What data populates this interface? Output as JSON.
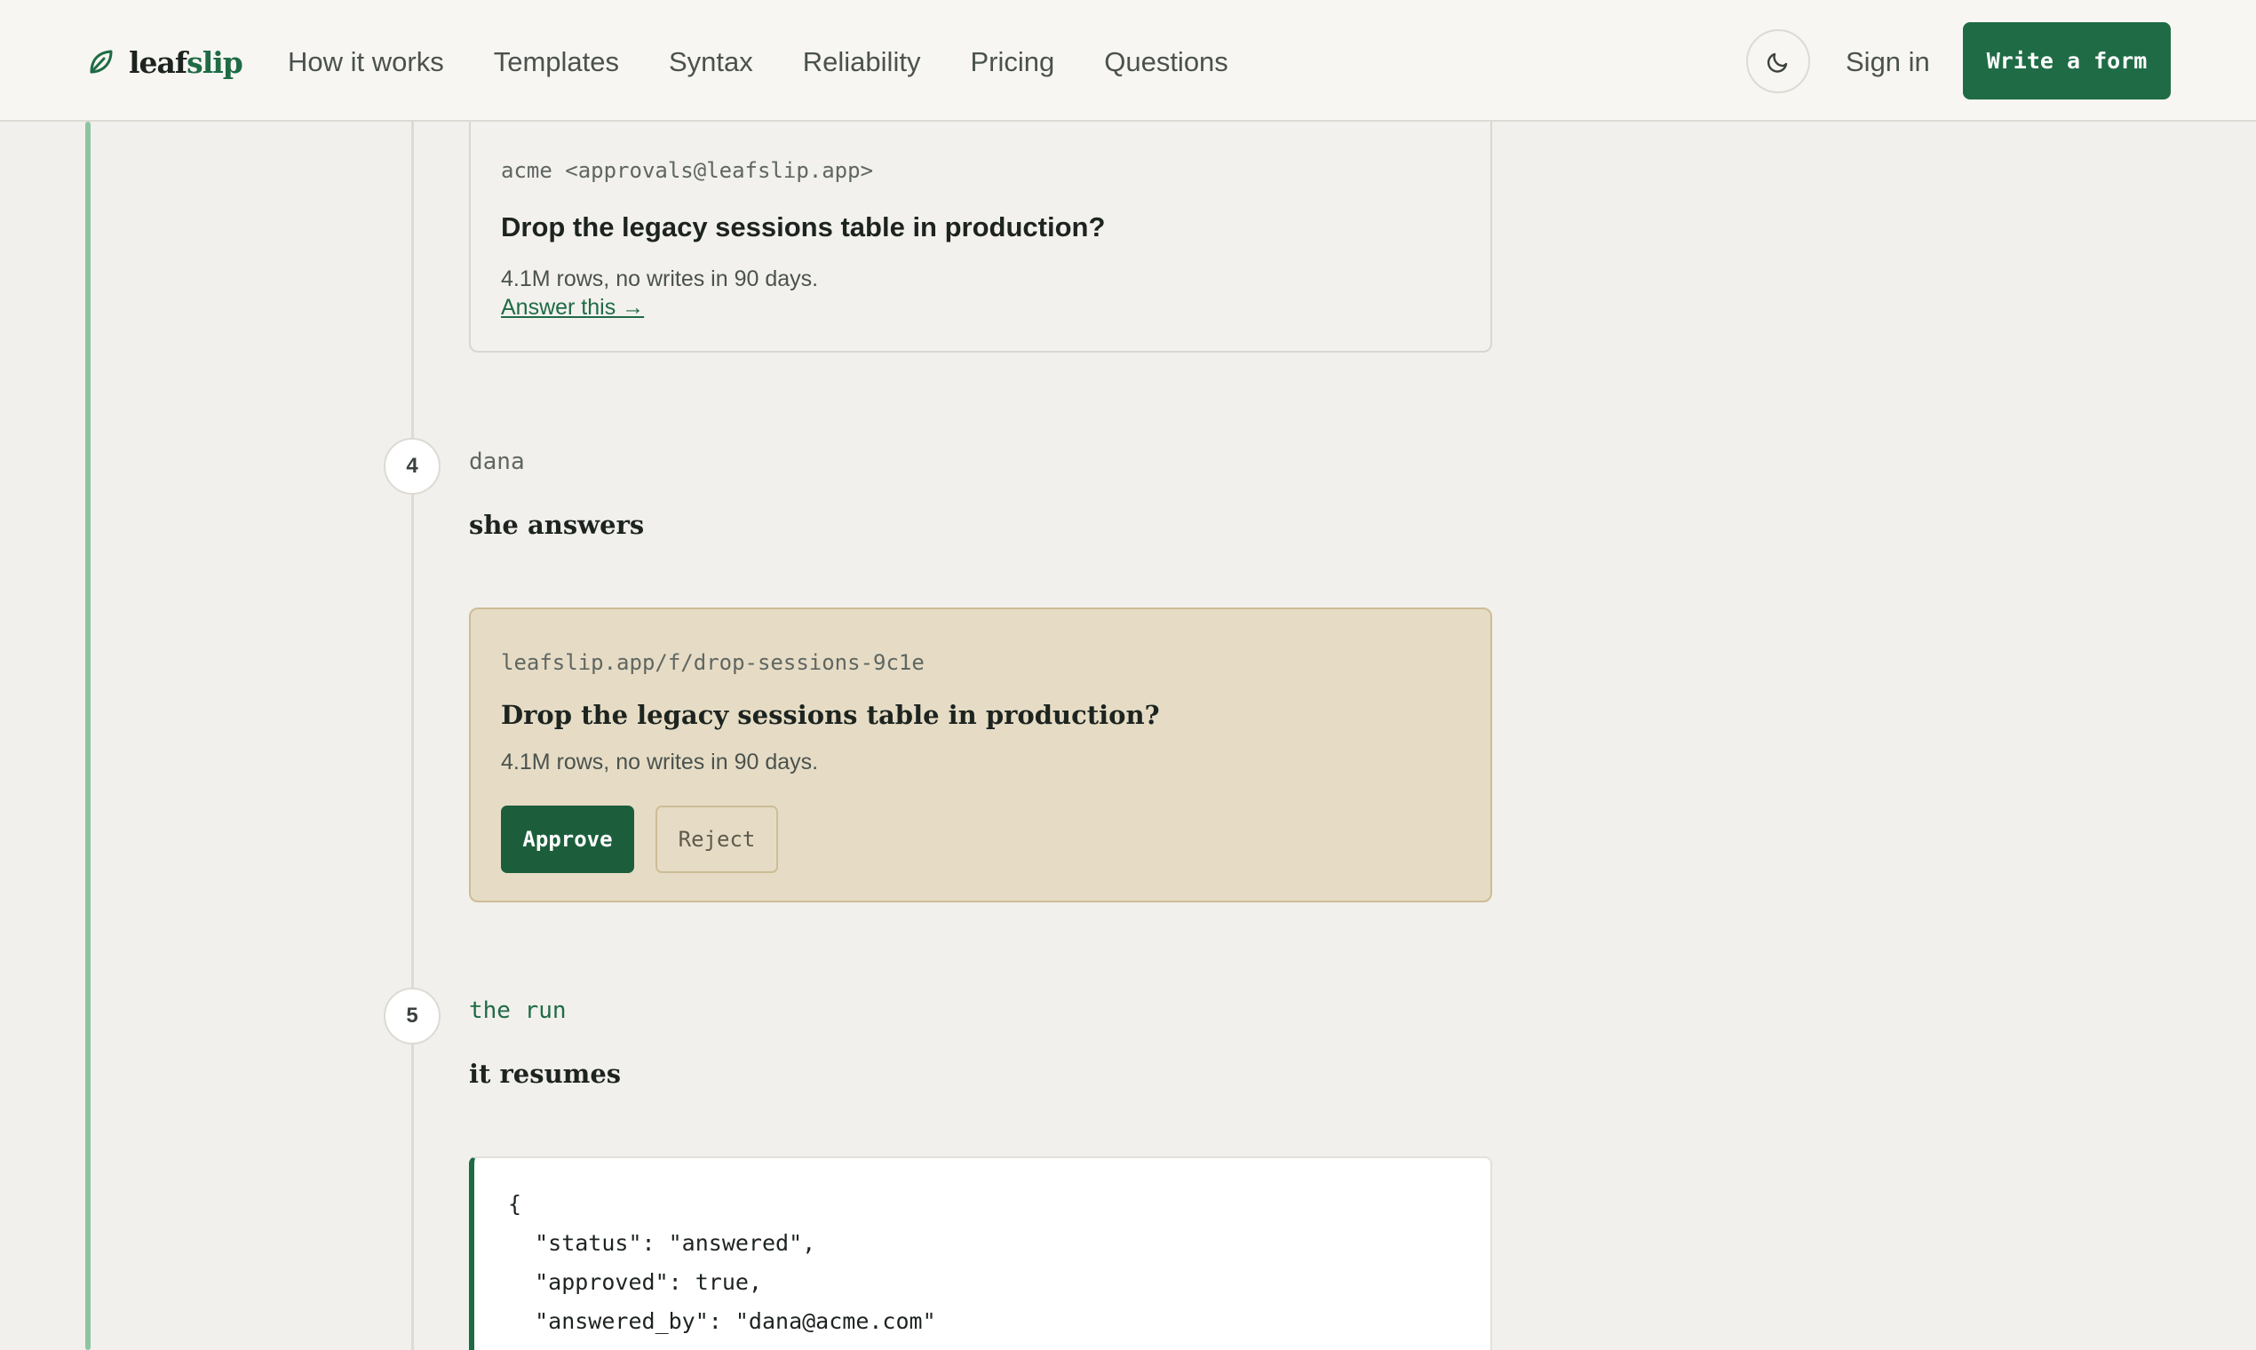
{
  "nav": {
    "brand_part1": "leaf",
    "brand_part2": "slip",
    "logo_icon": "leaf-icon",
    "links": [
      "How it works",
      "Templates",
      "Syntax",
      "Reliability",
      "Pricing",
      "Questions"
    ],
    "theme_icon": "moon-icon",
    "sign_in": "Sign in",
    "cta": "Write a form"
  },
  "email_card": {
    "from": "acme <approvals@leafslip.app>",
    "subject": "Drop the legacy sessions table in production?",
    "body": "4.1M rows, no writes in 90 days.",
    "link": "Answer this →"
  },
  "steps": [
    {
      "number": "4",
      "label": "dana",
      "title": "she answers"
    },
    {
      "number": "5",
      "label": "the run",
      "title": "it resumes"
    }
  ],
  "form_card": {
    "url": "leafslip.app/f/drop-sessions-9c1e",
    "question": "Drop the legacy sessions table in production?",
    "description": "4.1M rows, no writes in 90 days.",
    "approve": "Approve",
    "reject": "Reject"
  },
  "code_card": {
    "lines": [
      "{",
      "  \"status\": \"answered\",",
      "  \"approved\": true,",
      "  \"answered_by\": \"dana@acme.com\""
    ]
  },
  "colors": {
    "accent": "#1f6b45",
    "background": "#f1f0ec",
    "form_card_bg": "#e6dcc5",
    "rail": "#8ec49f"
  }
}
